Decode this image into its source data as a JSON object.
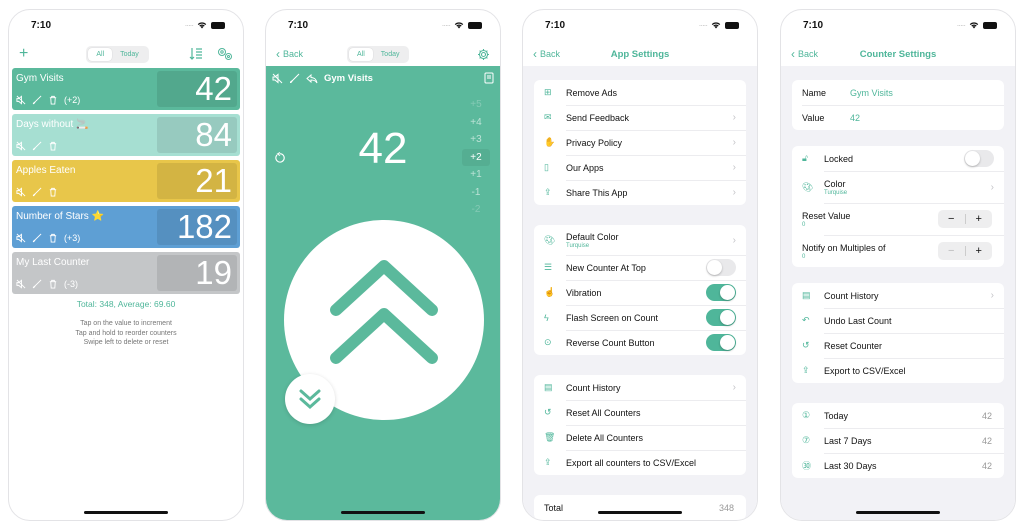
{
  "status": {
    "time": "7:10"
  },
  "colors": {
    "accent": "#4fb69a",
    "turquoise": "#5bb99c",
    "mint": "#a6dfd2",
    "yellow": "#e8c64a",
    "blue": "#5e9fd4",
    "gray": "#c4c6c8"
  },
  "screen1": {
    "segment": [
      "All",
      "Today"
    ],
    "counters": [
      {
        "name": "Gym Visits",
        "value": "42",
        "step": "(+2)",
        "color": "#5bb99c"
      },
      {
        "name": "Days without 🚬",
        "value": "84",
        "step": "",
        "color": "#a6dfd2"
      },
      {
        "name": "Apples Eaten",
        "value": "21",
        "step": "",
        "color": "#e8c64a"
      },
      {
        "name": "Number of Stars ⭐",
        "value": "182",
        "step": "(+3)",
        "color": "#5e9fd4"
      },
      {
        "name": "My Last Counter",
        "value": "19",
        "step": "(-3)",
        "color": "#c4c6c8"
      }
    ],
    "total": "Total: 348, Average: 69.60",
    "help": [
      "Tap on the value to increment",
      "Tap and hold to reorder counters",
      "Swipe left to delete or reset"
    ]
  },
  "screen2": {
    "back": "Back",
    "segment": [
      "All",
      "Today"
    ],
    "counter_name": "Gym Visits",
    "value": "42",
    "steps": [
      "+5",
      "+4",
      "+3",
      "+2",
      "+1",
      "-1",
      "-2"
    ],
    "current_step": "+2"
  },
  "screen3": {
    "back": "Back",
    "title": "App Settings",
    "group1": [
      {
        "icon": "gift-icon",
        "label": "Remove Ads",
        "chevron": false
      },
      {
        "icon": "mail-icon",
        "label": "Send Feedback",
        "chevron": true
      },
      {
        "icon": "hand-icon",
        "label": "Privacy Policy",
        "chevron": true
      },
      {
        "icon": "phone-icon",
        "label": "Our Apps",
        "chevron": true
      },
      {
        "icon": "share-icon",
        "label": "Share This App",
        "chevron": true
      }
    ],
    "group2": [
      {
        "label": "Default Color",
        "sub": "Turquise"
      },
      {
        "label": "New Counter At Top",
        "toggle": false
      },
      {
        "label": "Vibration",
        "toggle": true
      },
      {
        "label": "Flash Screen on Count",
        "toggle": true
      },
      {
        "label": "Reverse Count Button",
        "toggle": true
      }
    ],
    "group3": [
      {
        "label": "Count History"
      },
      {
        "label": "Reset All Counters"
      },
      {
        "label": "Delete All Counters"
      },
      {
        "label": "Export all counters to CSV/Excel"
      }
    ],
    "total_label": "Total",
    "total_value": "348"
  },
  "screen4": {
    "back": "Back",
    "title": "Counter Settings",
    "name_label": "Name",
    "name_value": "Gym Visits",
    "value_label": "Value",
    "value_value": "42",
    "locked_label": "Locked",
    "locked": false,
    "color_label": "Color",
    "color_sub": "Turquise",
    "reset_label": "Reset Value",
    "reset_value": "0",
    "notify_label": "Notify on Multiples of",
    "notify_value": "0",
    "actions": [
      "Count History",
      "Undo Last Count",
      "Reset Counter",
      "Export to CSV/Excel"
    ],
    "stats": [
      {
        "label": "Today",
        "value": "42"
      },
      {
        "label": "Last 7 Days",
        "value": "42"
      },
      {
        "label": "Last 30 Days",
        "value": "42"
      }
    ]
  }
}
